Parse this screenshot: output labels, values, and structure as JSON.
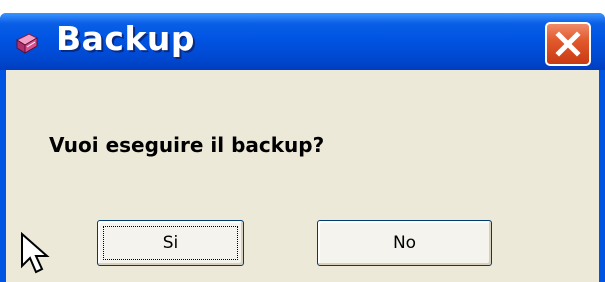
{
  "window": {
    "title": "Backup",
    "close_icon": "close-x-icon",
    "app_icon": "backup-book-icon"
  },
  "dialog": {
    "message": "Vuoi eseguire il backup?"
  },
  "buttons": {
    "yes_label": "Si",
    "no_label": "No"
  },
  "colors": {
    "titlebar": "#0054e3",
    "client": "#ece9d8",
    "close": "#e25a2e"
  },
  "cursor": "arrow-cursor-icon"
}
